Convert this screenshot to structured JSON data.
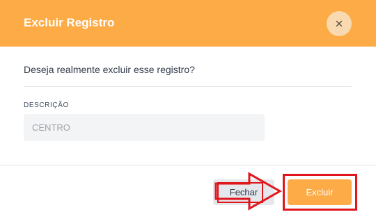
{
  "dialog": {
    "title": "Excluir Registro",
    "close_symbol": "×",
    "question": "Deseja realmente excluir esse registro?",
    "field": {
      "label": "DESCRIÇÃO",
      "value": "CENTRO"
    }
  },
  "footer": {
    "close_label": "Fechar",
    "delete_label": "Excluir"
  },
  "annotation": {
    "arrow_icon": "arrow-right-icon",
    "color": "#e0161d"
  },
  "colors": {
    "accent": "#fdab46",
    "secondary_button": "#e4e8ec"
  }
}
